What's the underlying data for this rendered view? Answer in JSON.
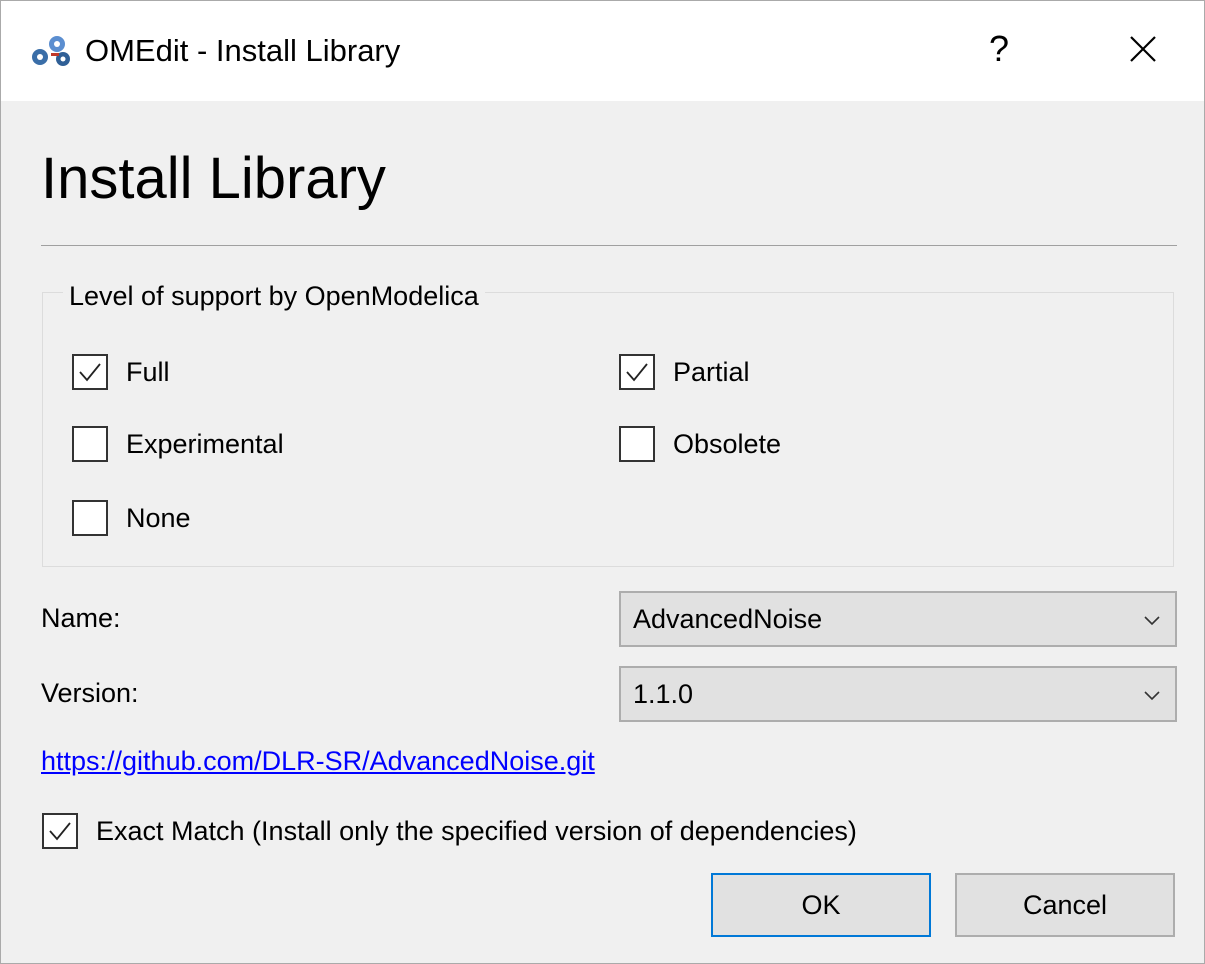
{
  "window": {
    "title": "OMEdit - Install Library",
    "help_label": "?",
    "icons": {
      "app": "omedit-gears-icon",
      "close": "close-icon"
    }
  },
  "heading": "Install Library",
  "support_group": {
    "title": "Level of support by OpenModelica",
    "options": [
      {
        "label": "Full",
        "checked": true
      },
      {
        "label": "Partial",
        "checked": true
      },
      {
        "label": "Experimental",
        "checked": false
      },
      {
        "label": "Obsolete",
        "checked": false
      },
      {
        "label": "None",
        "checked": false
      }
    ]
  },
  "form": {
    "name_label": "Name:",
    "name_value": "AdvancedNoise",
    "version_label": "Version:",
    "version_value": "1.1.0",
    "dropdown_icon": "chevron-down-icon"
  },
  "repo_link": "https://github.com/DLR-SR/AdvancedNoise.git",
  "exact_match": {
    "label": "Exact Match (Install only the specified version of dependencies)",
    "checked": true
  },
  "buttons": {
    "ok": "OK",
    "cancel": "Cancel"
  },
  "colors": {
    "accent": "#0078d7",
    "link": "#0000ff",
    "dialog_background": "#f0f0f0",
    "titlebar_background": "#ffffff"
  }
}
